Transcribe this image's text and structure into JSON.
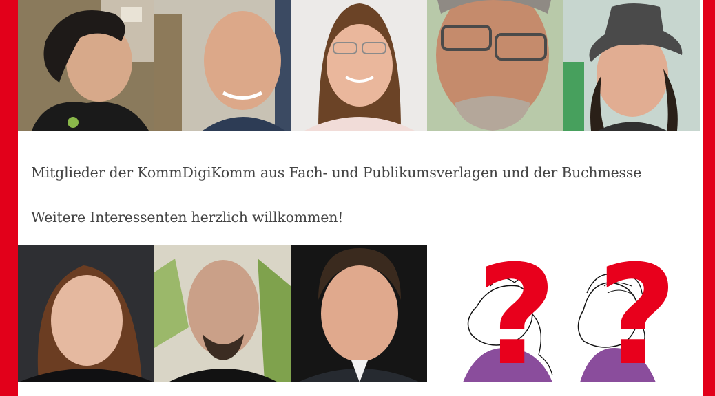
{
  "caption": {
    "members_line": "Mitglieder der KommDigiKomm aus Fach- und Publikumsverlagen und der Buchmesse",
    "welcome_line": "Weitere Interessenten herzlich willkommen!"
  },
  "colors": {
    "frame_red": "#e2001a",
    "question_mark_red": "#e8001c",
    "text_gray": "#444444"
  },
  "photos": {
    "top_row_count": 5,
    "bottom_row_count": 3,
    "placeholder_count": 2
  }
}
